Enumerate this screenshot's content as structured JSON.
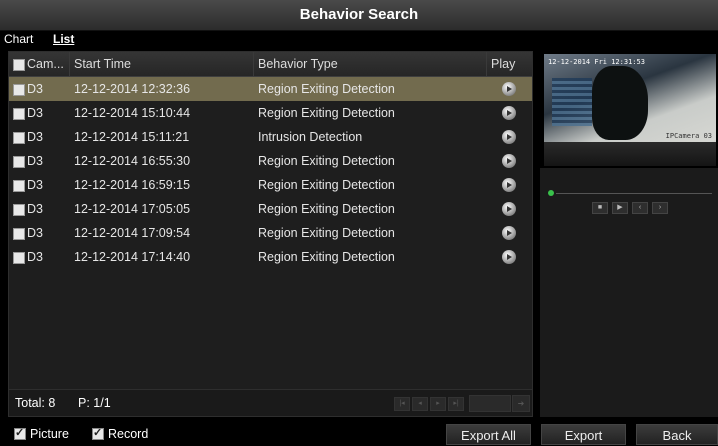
{
  "title": "Behavior Search",
  "tabs": [
    {
      "label": "Chart",
      "active": false
    },
    {
      "label": "List",
      "active": true
    }
  ],
  "table": {
    "headers": {
      "camera": "Cam...",
      "start_time": "Start Time",
      "behavior_type": "Behavior Type",
      "play": "Play"
    },
    "rows": [
      {
        "camera": "D3",
        "start_time": "12-12-2014 12:32:36",
        "behavior_type": "Region Exiting Detection",
        "selected": true
      },
      {
        "camera": "D3",
        "start_time": "12-12-2014 15:10:44",
        "behavior_type": "Region Exiting Detection",
        "selected": false
      },
      {
        "camera": "D3",
        "start_time": "12-12-2014 15:11:21",
        "behavior_type": "Intrusion Detection",
        "selected": false
      },
      {
        "camera": "D3",
        "start_time": "12-12-2014 16:55:30",
        "behavior_type": "Region Exiting Detection",
        "selected": false
      },
      {
        "camera": "D3",
        "start_time": "12-12-2014 16:59:15",
        "behavior_type": "Region Exiting Detection",
        "selected": false
      },
      {
        "camera": "D3",
        "start_time": "12-12-2014 17:05:05",
        "behavior_type": "Region Exiting Detection",
        "selected": false
      },
      {
        "camera": "D3",
        "start_time": "12-12-2014 17:09:54",
        "behavior_type": "Region Exiting Detection",
        "selected": false
      },
      {
        "camera": "D3",
        "start_time": "12-12-2014 17:14:40",
        "behavior_type": "Region Exiting Detection",
        "selected": false
      }
    ]
  },
  "footer": {
    "total": "Total: 8",
    "page": "P: 1/1"
  },
  "preview": {
    "timestamp": "12-12-2014 Fri 12:31:53",
    "camera_label": "IPCamera 03"
  },
  "bottom": {
    "picture_label": "Picture",
    "record_label": "Record",
    "export_all_label": "Export All",
    "export_label": "Export",
    "back_label": "Back"
  },
  "colors": {
    "selected_row": "#726b4e",
    "progress_dot": "#39c14b"
  }
}
